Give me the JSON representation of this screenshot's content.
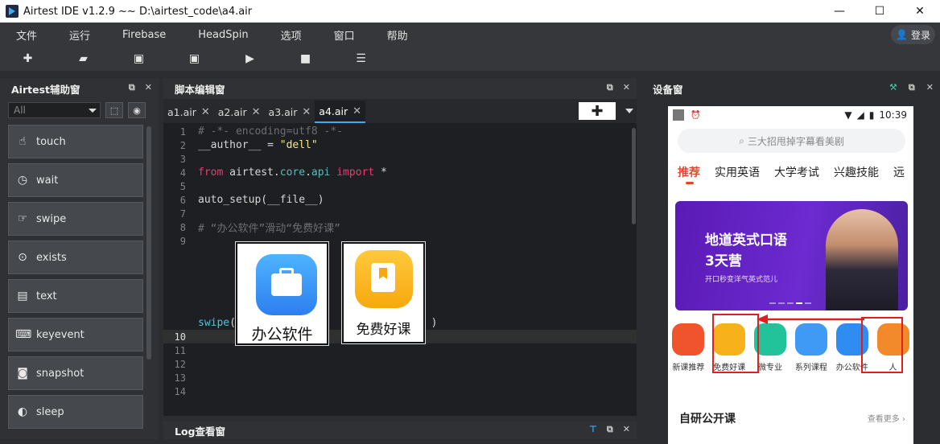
{
  "app": {
    "title": "Airtest IDE v1.2.9 ~~ D:\\airtest_code\\a4.air",
    "window": {
      "minimize": "—",
      "maximize": "☐",
      "close": "✕"
    }
  },
  "menu": {
    "items": [
      "文件",
      "运行",
      "Firebase",
      "HeadSpin",
      "选项",
      "窗口",
      "帮助"
    ],
    "login": "登录"
  },
  "toolbar": {
    "icons": [
      "plus-icon",
      "folder-icon",
      "save-icon",
      "save-as-icon",
      "play-icon",
      "stop-icon",
      "log-icon"
    ]
  },
  "left_panel": {
    "title": "Airtest辅助窗",
    "filter": "All",
    "actions": [
      {
        "label": "touch",
        "icon": "hand-icon"
      },
      {
        "label": "wait",
        "icon": "clock-icon"
      },
      {
        "label": "swipe",
        "icon": "swipe-icon"
      },
      {
        "label": "exists",
        "icon": "magnifier-icon"
      },
      {
        "label": "text",
        "icon": "text-icon"
      },
      {
        "label": "keyevent",
        "icon": "keyboard-icon"
      },
      {
        "label": "snapshot",
        "icon": "camera-icon"
      },
      {
        "label": "sleep",
        "icon": "moon-icon"
      }
    ]
  },
  "editor": {
    "title": "脚本编辑窗",
    "tabs": [
      "a1.air",
      "a2.air",
      "a3.air",
      "a4.air"
    ],
    "active_tab": "a4.air",
    "lines": [
      {
        "n": "1",
        "parts": [
          {
            "c": "cm",
            "t": "# -*- encoding=utf8 -*-"
          }
        ]
      },
      {
        "n": "2",
        "parts": [
          {
            "c": "",
            "t": "__author__ = "
          },
          {
            "c": "str",
            "t": "\"dell\""
          }
        ]
      },
      {
        "n": "3",
        "parts": []
      },
      {
        "n": "4",
        "parts": [
          {
            "c": "kw",
            "t": "from"
          },
          {
            "c": "",
            "t": " airtest."
          },
          {
            "c": "mod",
            "t": "core"
          },
          {
            "c": "",
            "t": "."
          },
          {
            "c": "mod",
            "t": "api"
          },
          {
            "c": "",
            "t": " "
          },
          {
            "c": "kw",
            "t": "import"
          },
          {
            "c": "",
            "t": " *"
          }
        ]
      },
      {
        "n": "5",
        "parts": []
      },
      {
        "n": "6",
        "parts": [
          {
            "c": "",
            "t": "auto_setup(__file__)"
          }
        ]
      },
      {
        "n": "7",
        "parts": []
      },
      {
        "n": "8",
        "parts": [
          {
            "c": "cm",
            "t": "# “办公软件”滑动“免费好课”"
          }
        ]
      },
      {
        "n": "9",
        "parts": []
      },
      {
        "n": "",
        "parts": []
      },
      {
        "n": "",
        "parts": []
      },
      {
        "n": "",
        "parts": []
      },
      {
        "n": "",
        "parts": []
      },
      {
        "n": "",
        "parts": []
      },
      {
        "n": "",
        "parts": [
          {
            "c": "fn",
            "t": "swipe"
          },
          {
            "c": "",
            "t": "(                  ,            )"
          }
        ]
      },
      {
        "n": "10",
        "parts": [
          {
            "c": "",
            "t": ""
          }
        ]
      },
      {
        "n": "11",
        "parts": []
      },
      {
        "n": "12",
        "parts": []
      },
      {
        "n": "13",
        "parts": []
      },
      {
        "n": "14",
        "parts": []
      }
    ],
    "images": [
      {
        "label": "办公软件"
      },
      {
        "label": "免费好课"
      }
    ]
  },
  "log_panel": {
    "title": "Log查看窗"
  },
  "device_panel": {
    "title": "设备窗",
    "status_time": "10:39",
    "search": "三大招甩掉字幕看美剧",
    "categories": [
      "推荐",
      "实用英语",
      "大学考试",
      "兴趣技能",
      "远"
    ],
    "banner": {
      "line1": "地道英式口语",
      "line2": "3天营",
      "line3": "开口秒变洋气英式范儿"
    },
    "icons": [
      {
        "label": "新课推荐",
        "color": "#f0542d"
      },
      {
        "label": "免费好课",
        "color": "#f7b21b"
      },
      {
        "label": "微专业",
        "color": "#22c39a"
      },
      {
        "label": "系列课程",
        "color": "#3f9af5"
      },
      {
        "label": "办公软件",
        "color": "#2f8cf0"
      },
      {
        "label": "人",
        "color": "#f28a2b"
      }
    ],
    "section": "自研公开课",
    "more": "查看更多 ›"
  }
}
